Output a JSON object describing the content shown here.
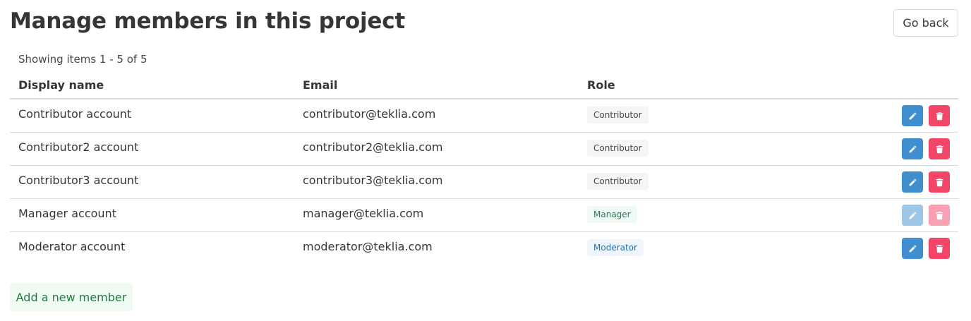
{
  "header": {
    "title": "Manage members in this project",
    "go_back_label": "Go back"
  },
  "pagination": {
    "text": "Showing items 1 - 5 of 5"
  },
  "table": {
    "columns": [
      "Display name",
      "Email",
      "Role"
    ],
    "rows": [
      {
        "display_name": "Contributor account",
        "email": "contributor@teklia.com",
        "role": "Contributor",
        "role_style": "contributor",
        "actions_enabled": true
      },
      {
        "display_name": "Contributor2 account",
        "email": "contributor2@teklia.com",
        "role": "Contributor",
        "role_style": "contributor",
        "actions_enabled": true
      },
      {
        "display_name": "Contributor3 account",
        "email": "contributor3@teklia.com",
        "role": "Contributor",
        "role_style": "contributor",
        "actions_enabled": true
      },
      {
        "display_name": "Manager account",
        "email": "manager@teklia.com",
        "role": "Manager",
        "role_style": "manager",
        "actions_enabled": false
      },
      {
        "display_name": "Moderator account",
        "email": "moderator@teklia.com",
        "role": "Moderator",
        "role_style": "moderator",
        "actions_enabled": true
      }
    ],
    "row_actions": {
      "edit_icon": "pencil-icon",
      "delete_icon": "trash-icon"
    }
  },
  "footer": {
    "add_member_label": "Add a new member"
  },
  "colors": {
    "edit_button": "#3e8ed0",
    "delete_button": "#f14668",
    "tag_contributor_bg": "#f5f5f5",
    "tag_contributor_text": "#4a4a4a",
    "tag_manager_bg": "#effaf5",
    "tag_manager_text": "#257953",
    "tag_moderator_bg": "#eff5fb",
    "tag_moderator_text": "#296fa8"
  }
}
